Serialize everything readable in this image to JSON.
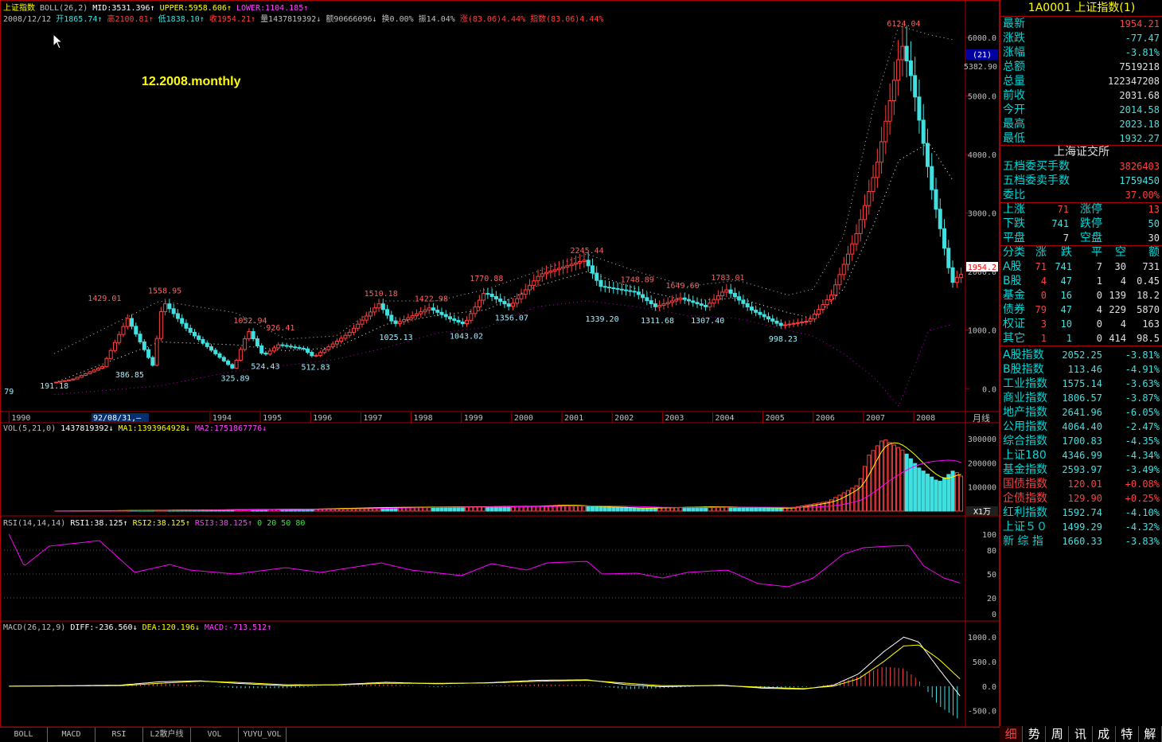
{
  "title_line": {
    "name": "上证指数",
    "indicator": "BOLL(26,2)",
    "mid": "MID:3531.396↑",
    "upper": "UPPER:5958.606↑",
    "lower": "LOWER:1104.185↑"
  },
  "info_line": {
    "date": "2008/12/12",
    "open": "开1865.74↑",
    "high": "高2100.81↑",
    "low": "低1838.10↑",
    "close": "收1954.21↑",
    "volume": "量1437819392↓",
    "amount": "额90666096↓",
    "turnover": "换0.00%",
    "amplitude": "振14.04%",
    "change": "涨(83.06)4.44%",
    "index_change": "指数(83.06)4.44%"
  },
  "watermark": "12.2008.monthly",
  "colors": {
    "up": "#ff4040",
    "down": "#40e0e0",
    "upper": "#c0c0c0",
    "mid": "#ffffff",
    "lower": "#c000c0",
    "frame": "#aa0000",
    "yellow": "#ffff00",
    "vol_ma1": "#ffff00",
    "vol_ma2": "#ff00ff"
  },
  "price_axis": {
    "labels": [
      "6000.0",
      "5000.0",
      "4000.0",
      "3000.0",
      "2000.0",
      "1000.0",
      "0.0"
    ],
    "box_top": "(21)",
    "box_value": "5382.90",
    "current": "1954.2"
  },
  "annotations": [
    {
      "text": "6124.04",
      "year": 2007.8,
      "value": 6124,
      "type": "high"
    },
    {
      "text": "1429.01",
      "year": 1991.9,
      "value": 1429,
      "type": "high"
    },
    {
      "text": "1558.95",
      "year": 1993.1,
      "value": 1559,
      "type": "high"
    },
    {
      "text": "1052.94",
      "year": 1994.8,
      "value": 1053,
      "type": "high"
    },
    {
      "text": "926.41",
      "year": 1995.4,
      "value": 926,
      "type": "high"
    },
    {
      "text": "1510.18",
      "year": 1997.4,
      "value": 1510,
      "type": "high"
    },
    {
      "text": "1422.98",
      "year": 1998.4,
      "value": 1423,
      "type": "high"
    },
    {
      "text": "1770.88",
      "year": 1999.5,
      "value": 1771,
      "type": "high"
    },
    {
      "text": "2245.44",
      "year": 2001.5,
      "value": 2245,
      "type": "high"
    },
    {
      "text": "1748.89",
      "year": 2002.5,
      "value": 1749,
      "type": "high"
    },
    {
      "text": "1649.60",
      "year": 2003.4,
      "value": 1650,
      "type": "high"
    },
    {
      "text": "1783.01",
      "year": 2004.3,
      "value": 1783,
      "type": "high"
    },
    {
      "text": "191.18",
      "year": 1990.9,
      "value": 191,
      "type": "low"
    },
    {
      "text": "386.85",
      "year": 1992.4,
      "value": 387,
      "type": "low"
    },
    {
      "text": "325.89",
      "year": 1994.5,
      "value": 326,
      "type": "low"
    },
    {
      "text": "524.43",
      "year": 1995.1,
      "value": 524,
      "type": "low"
    },
    {
      "text": "512.83",
      "year": 1996.1,
      "value": 513,
      "type": "low"
    },
    {
      "text": "1025.13",
      "year": 1997.7,
      "value": 1025,
      "type": "low"
    },
    {
      "text": "1043.02",
      "year": 1999.1,
      "value": 1043,
      "type": "low"
    },
    {
      "text": "1356.07",
      "year": 2000.0,
      "value": 1356,
      "type": "low"
    },
    {
      "text": "1339.20",
      "year": 2001.8,
      "value": 1339,
      "type": "low"
    },
    {
      "text": "1311.68",
      "year": 2002.9,
      "value": 1312,
      "type": "low"
    },
    {
      "text": "1307.40",
      "year": 2003.9,
      "value": 1307,
      "type": "low"
    },
    {
      "text": "998.23",
      "year": 2005.4,
      "value": 998,
      "type": "low"
    },
    {
      "text": "79",
      "year": 1990.0,
      "value": 96,
      "type": "low"
    }
  ],
  "years": [
    "1990",
    "1992",
    "1994",
    "1995",
    "1996",
    "1997",
    "1998",
    "1999",
    "2000",
    "2001",
    "2002",
    "2003",
    "2004",
    "2005",
    "2006",
    "2007",
    "2008"
  ],
  "cursor_date": "92/08/31,—",
  "period_label": "月线",
  "vol_panel": {
    "title": "VOL(5,21,0)",
    "value": "1437819392↓",
    "ma1": "MA1:1393964928↓",
    "ma2": "MA2:1751867776↓",
    "axis": [
      "300000",
      "200000",
      "100000"
    ],
    "unit": "X1万"
  },
  "rsi_panel": {
    "title": "RSI(14,14,14)",
    "rsi1": "RSI1:38.125↑",
    "rsi2": "RSI2:38.125↑",
    "rsi3": "RSI3:38.125↑",
    "levels": "0  20  50  80",
    "axis": [
      "100",
      "80",
      "50",
      "20",
      "0"
    ]
  },
  "macd_panel": {
    "title": "MACD(26,12,9)",
    "diff": "DIFF:-236.560↓",
    "dea": "DEA:120.196↓",
    "macd": "MACD:-713.512↑",
    "axis": [
      "1000.0",
      "500.0",
      "0.0",
      "-500.0"
    ]
  },
  "sidebar": {
    "header": "1A0001 上证指数(1)",
    "quote": [
      {
        "label": "最新",
        "value": "1954.21",
        "color": "#ff4040"
      },
      {
        "label": "涨跌",
        "value": "-77.47",
        "color": "#40e0e0"
      },
      {
        "label": "涨幅",
        "value": "-3.81%",
        "color": "#40e0e0"
      },
      {
        "label": "总额",
        "value": "7519218",
        "color": "#e0e0e0"
      },
      {
        "label": "总量",
        "value": "122347208",
        "color": "#e0e0e0"
      },
      {
        "label": "前收",
        "value": "2031.68",
        "color": "#e0e0e0"
      },
      {
        "label": "今开",
        "value": "2014.58",
        "color": "#40e0e0"
      },
      {
        "label": "最高",
        "value": "2023.18",
        "color": "#40e0e0"
      },
      {
        "label": "最低",
        "value": "1932.27",
        "color": "#40e0e0"
      }
    ],
    "exchange": "上海证交所",
    "orders": [
      {
        "label": "五档委买手数",
        "value": "3826403",
        "color": "#ff4040"
      },
      {
        "label": "五档委卖手数",
        "value": "1759450",
        "color": "#40e0e0"
      },
      {
        "label": "委比",
        "value": "37.00%",
        "color": "#ff4040"
      }
    ],
    "breadth": [
      {
        "l1": "上涨",
        "v1": "71",
        "c1": "#ff4040",
        "l2": "涨停",
        "v2": "13",
        "c2": "#ff4040"
      },
      {
        "l1": "下跌",
        "v1": "741",
        "c1": "#40e0e0",
        "l2": "跌停",
        "v2": "50",
        "c2": "#40e0e0"
      },
      {
        "l1": "平盘",
        "v1": "7",
        "c1": "#e0e0e0",
        "l2": "空盘",
        "v2": "30",
        "c2": "#e0e0e0"
      }
    ],
    "table_header": [
      "分类",
      "涨",
      "跌",
      "平",
      "空",
      "额"
    ],
    "table_rows": [
      [
        "A股",
        "71",
        "741",
        "7",
        "30",
        "731"
      ],
      [
        "B股",
        "4",
        "47",
        "1",
        "4",
        "0.45"
      ],
      [
        "基金",
        "0",
        "16",
        "0",
        "139",
        "18.2"
      ],
      [
        "债券",
        "79",
        "47",
        "4",
        "229",
        "5870"
      ],
      [
        "权证",
        "3",
        "10",
        "0",
        "4",
        "163"
      ],
      [
        "其它",
        "1",
        "1",
        "0",
        "414",
        "98.5"
      ]
    ],
    "indices": [
      {
        "name": "A股指数",
        "value": "2052.25",
        "chg": "-3.81%",
        "up": false
      },
      {
        "name": "B股指数",
        "value": "113.46",
        "chg": "-4.91%",
        "up": false
      },
      {
        "name": "工业指数",
        "value": "1575.14",
        "chg": "-3.63%",
        "up": false
      },
      {
        "name": "商业指数",
        "value": "1806.57",
        "chg": "-3.87%",
        "up": false
      },
      {
        "name": "地产指数",
        "value": "2641.96",
        "chg": "-6.05%",
        "up": false
      },
      {
        "name": "公用指数",
        "value": "4064.40",
        "chg": "-2.47%",
        "up": false
      },
      {
        "name": "综合指数",
        "value": "1700.83",
        "chg": "-4.35%",
        "up": false
      },
      {
        "name": "上证180",
        "value": "4346.99",
        "chg": "-4.34%",
        "up": false
      },
      {
        "name": "基金指数",
        "value": "2593.97",
        "chg": "-3.49%",
        "up": false
      },
      {
        "name": "国债指数",
        "value": "120.01",
        "chg": "+0.08%",
        "up": true
      },
      {
        "name": "企债指数",
        "value": "129.90",
        "chg": "+0.25%",
        "up": true
      },
      {
        "name": "红利指数",
        "value": "1592.74",
        "chg": "-4.10%",
        "up": false
      },
      {
        "name": "上证５０",
        "value": "1499.29",
        "chg": "-4.32%",
        "up": false
      },
      {
        "name": "新 综 指",
        "value": "1660.33",
        "chg": "-3.83%",
        "up": false
      }
    ]
  },
  "bottom_tabs": [
    "BOLL",
    "MACD",
    "RSI",
    "L2散户线",
    "VOL",
    "YUYU_VOL"
  ],
  "nav_tabs": [
    "细",
    "势",
    "周",
    "讯",
    "成",
    "特",
    "解"
  ],
  "chart_data": {
    "type": "candlestick",
    "frequency": "monthly",
    "x_range": [
      1989.9,
      2008.98
    ],
    "price_ylim": [
      -350,
      6450
    ],
    "keypoints": [
      [
        1990.9,
        100
      ],
      [
        1991.3,
        160
      ],
      [
        1991.9,
        380
      ],
      [
        1992.4,
        1200
      ],
      [
        1992.9,
        400
      ],
      [
        1993.1,
        1500
      ],
      [
        1993.6,
        1000
      ],
      [
        1994.5,
        340
      ],
      [
        1994.8,
        1000
      ],
      [
        1995.1,
        560
      ],
      [
        1995.4,
        750
      ],
      [
        1995.9,
        680
      ],
      [
        1996.1,
        540
      ],
      [
        1996.8,
        950
      ],
      [
        1997.4,
        1450
      ],
      [
        1997.7,
        1100
      ],
      [
        1998.4,
        1380
      ],
      [
        1998.8,
        1200
      ],
      [
        1999.1,
        1100
      ],
      [
        1999.5,
        1650
      ],
      [
        2000.0,
        1400
      ],
      [
        2000.6,
        1950
      ],
      [
        2001.5,
        2200
      ],
      [
        2001.8,
        1750
      ],
      [
        2002.5,
        1650
      ],
      [
        2002.9,
        1400
      ],
      [
        2003.4,
        1550
      ],
      [
        2003.9,
        1400
      ],
      [
        2004.3,
        1700
      ],
      [
        2004.8,
        1350
      ],
      [
        2005.4,
        1080
      ],
      [
        2005.95,
        1160
      ],
      [
        2006.4,
        1600
      ],
      [
        2006.9,
        2650
      ],
      [
        2007.3,
        3800
      ],
      [
        2007.8,
        5900
      ],
      [
        2008.0,
        5300
      ],
      [
        2008.4,
        3400
      ],
      [
        2008.8,
        1800
      ],
      [
        2008.95,
        1954
      ]
    ],
    "boll_upper": [
      [
        1990.9,
        600
      ],
      [
        1993.0,
        1500
      ],
      [
        1994.5,
        1300
      ],
      [
        1995.5,
        850
      ],
      [
        1996.5,
        900
      ],
      [
        1997.5,
        1500
      ],
      [
        1998.5,
        1500
      ],
      [
        1999.5,
        1700
      ],
      [
        2000.5,
        2000
      ],
      [
        2001.5,
        2300
      ],
      [
        2002.5,
        2000
      ],
      [
        2003.5,
        1750
      ],
      [
        2004.5,
        1850
      ],
      [
        2005.5,
        1600
      ],
      [
        2006.0,
        1700
      ],
      [
        2006.6,
        2600
      ],
      [
        2007.2,
        4800
      ],
      [
        2007.7,
        6200
      ],
      [
        2008.3,
        6050
      ],
      [
        2008.8,
        5958
      ]
    ],
    "boll_mid": [
      [
        1990.9,
        100
      ],
      [
        1993.0,
        800
      ],
      [
        1994.5,
        750
      ],
      [
        1995.5,
        650
      ],
      [
        1996.5,
        700
      ],
      [
        1997.5,
        1100
      ],
      [
        1998.5,
        1250
      ],
      [
        1999.5,
        1350
      ],
      [
        2000.5,
        1750
      ],
      [
        2001.5,
        2000
      ],
      [
        2002.5,
        1700
      ],
      [
        2003.5,
        1500
      ],
      [
        2004.5,
        1550
      ],
      [
        2005.5,
        1300
      ],
      [
        2006.0,
        1200
      ],
      [
        2006.6,
        1700
      ],
      [
        2007.2,
        2800
      ],
      [
        2007.7,
        3900
      ],
      [
        2008.3,
        4200
      ],
      [
        2008.8,
        3531
      ]
    ],
    "boll_lower": [
      [
        1990.9,
        -100
      ],
      [
        1993.0,
        50
      ],
      [
        1994.5,
        300
      ],
      [
        1995.5,
        400
      ],
      [
        1996.5,
        500
      ],
      [
        1997.5,
        700
      ],
      [
        1998.5,
        950
      ],
      [
        1999.5,
        1050
      ],
      [
        2000.5,
        1400
      ],
      [
        2001.5,
        1500
      ],
      [
        2002.5,
        1400
      ],
      [
        2003.5,
        1250
      ],
      [
        2004.5,
        1200
      ],
      [
        2005.5,
        1000
      ],
      [
        2006.0,
        900
      ],
      [
        2006.6,
        600
      ],
      [
        2007.2,
        200
      ],
      [
        2007.7,
        -300
      ],
      [
        2008.3,
        1000
      ],
      [
        2008.8,
        1104
      ]
    ],
    "volume_ylim": [
      0,
      320000
    ],
    "volume_keypoints": [
      [
        1990.9,
        200
      ],
      [
        1996.0,
        8000
      ],
      [
        1997.4,
        15000
      ],
      [
        2000.5,
        20000
      ],
      [
        2001.0,
        25000
      ],
      [
        2002.5,
        12000
      ],
      [
        2004.0,
        18000
      ],
      [
        2005.5,
        12000
      ],
      [
        2006.3,
        40000
      ],
      [
        2006.9,
        110000
      ],
      [
        2007.1,
        230000
      ],
      [
        2007.4,
        300000
      ],
      [
        2007.8,
        250000
      ],
      [
        2008.1,
        180000
      ],
      [
        2008.5,
        120000
      ],
      [
        2008.8,
        170000
      ],
      [
        2008.95,
        143782
      ]
    ],
    "rsi_keypoints": [
      [
        1990.0,
        100
      ],
      [
        1990.3,
        60
      ],
      [
        1990.8,
        85
      ],
      [
        1991.8,
        92
      ],
      [
        1992.5,
        52
      ],
      [
        1993.2,
        62
      ],
      [
        1993.6,
        55
      ],
      [
        1994.5,
        50
      ],
      [
        1995.5,
        58
      ],
      [
        1996.2,
        52
      ],
      [
        1997.4,
        64
      ],
      [
        1998.0,
        55
      ],
      [
        1999.0,
        48
      ],
      [
        1999.6,
        63
      ],
      [
        2000.3,
        55
      ],
      [
        2000.7,
        64
      ],
      [
        2001.5,
        66
      ],
      [
        2001.8,
        50
      ],
      [
        2002.5,
        51
      ],
      [
        2003.0,
        45
      ],
      [
        2003.5,
        52
      ],
      [
        2004.3,
        55
      ],
      [
        2004.9,
        38
      ],
      [
        2005.5,
        34
      ],
      [
        2006.0,
        45
      ],
      [
        2006.6,
        75
      ],
      [
        2007.0,
        83
      ],
      [
        2007.5,
        85
      ],
      [
        2007.9,
        86
      ],
      [
        2008.2,
        60
      ],
      [
        2008.6,
        45
      ],
      [
        2008.95,
        38.125
      ]
    ],
    "rsi_ylim": [
      -5,
      110
    ],
    "macd_ylim": [
      -780,
      1150
    ],
    "macd_diff": [
      [
        1990.0,
        0
      ],
      [
        1992.2,
        20
      ],
      [
        1993.0,
        90
      ],
      [
        1993.8,
        110
      ],
      [
        1994.5,
        60
      ],
      [
        1995.5,
        10
      ],
      [
        1996.5,
        30
      ],
      [
        1997.5,
        80
      ],
      [
        1998.5,
        50
      ],
      [
        1999.5,
        70
      ],
      [
        2000.5,
        120
      ],
      [
        2001.5,
        130
      ],
      [
        2002.3,
        30
      ],
      [
        2003.0,
        -10
      ],
      [
        2004.2,
        20
      ],
      [
        2005.0,
        -40
      ],
      [
        2005.8,
        -60
      ],
      [
        2006.4,
        20
      ],
      [
        2006.9,
        250
      ],
      [
        2007.4,
        700
      ],
      [
        2007.8,
        1000
      ],
      [
        2008.1,
        900
      ],
      [
        2008.5,
        350
      ],
      [
        2008.95,
        -236.56
      ]
    ],
    "macd_dea": [
      [
        1990.0,
        0
      ],
      [
        1992.2,
        10
      ],
      [
        1993.0,
        60
      ],
      [
        1993.8,
        100
      ],
      [
        1994.5,
        80
      ],
      [
        1995.5,
        30
      ],
      [
        1996.5,
        25
      ],
      [
        1997.5,
        60
      ],
      [
        1998.5,
        60
      ],
      [
        1999.5,
        65
      ],
      [
        2000.5,
        100
      ],
      [
        2001.5,
        120
      ],
      [
        2002.3,
        60
      ],
      [
        2003.0,
        10
      ],
      [
        2004.2,
        10
      ],
      [
        2005.0,
        -20
      ],
      [
        2005.8,
        -50
      ],
      [
        2006.4,
        0
      ],
      [
        2006.9,
        150
      ],
      [
        2007.4,
        500
      ],
      [
        2007.8,
        820
      ],
      [
        2008.1,
        840
      ],
      [
        2008.5,
        550
      ],
      [
        2008.95,
        120.196
      ]
    ]
  }
}
